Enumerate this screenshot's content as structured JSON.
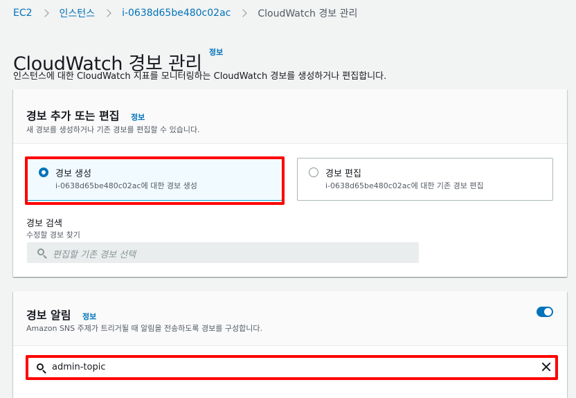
{
  "breadcrumb": {
    "items": [
      "EC2",
      "인스턴스",
      "i-0638d65be480c02ac"
    ],
    "current": "CloudWatch 경보 관리"
  },
  "page": {
    "title": "CloudWatch 경보 관리",
    "info": "정보",
    "description": "인스턴스에 대한 CloudWatch 지표를 모니터링하는 CloudWatch 경보를 생성하거나 편집합니다."
  },
  "alarm_panel": {
    "title": "경보 추가 또는 편집",
    "info": "정보",
    "subtitle": "새 경보를 생성하거나 기존 경보를 편집할 수 있습니다.",
    "options": [
      {
        "label": "경보 생성",
        "desc": "i-0638d65be480c02ac에 대한 경보 생성",
        "selected": true
      },
      {
        "label": "경보 편집",
        "desc": "i-0638d65be480c02ac에 대한 기존 경보 편집",
        "selected": false
      }
    ],
    "search": {
      "label": "경보 검색",
      "desc": "수정할 경보 찾기",
      "placeholder": "편집할 기존 경보 선택"
    }
  },
  "notification_panel": {
    "title": "경보 알림",
    "info": "정보",
    "subtitle": "Amazon SNS 주제가 트리거될 때 알림을 전송하도록 경보를 구성합니다.",
    "enabled": true,
    "topic_value": "admin-topic"
  },
  "colors": {
    "link": "#0073bb",
    "highlight": "#ff0000",
    "selected_bg": "#f1faff"
  }
}
